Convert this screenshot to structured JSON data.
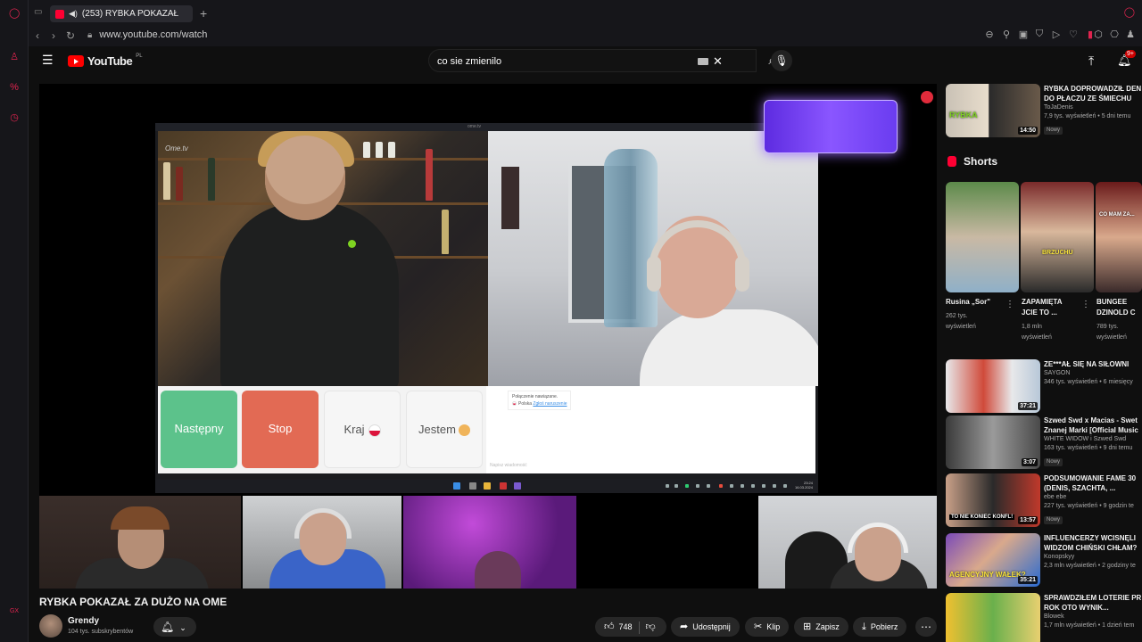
{
  "browser": {
    "tab_title": "(253) RYBKA POKAZAŁ",
    "url": "www.youtube.com/watch",
    "new_tab": "+"
  },
  "youtube": {
    "logo_text": "YouTube",
    "country_code": "PL",
    "search_query": "co sie zmienilo",
    "notification_count": "9+"
  },
  "player": {
    "omegle_logo": "Ome.tv",
    "screen_url": "ome.tv",
    "buttons": {
      "next": "Następny",
      "stop": "Stop",
      "country": "Kraj",
      "gender": "Jestem"
    },
    "chat": {
      "line1": "Połączenie nawiązane.",
      "line2_country": "Polska",
      "line2_link": "Zgłoś naruszenie",
      "input_placeholder": "Napisz wiadomość"
    },
    "clock_time": "23:24",
    "clock_date": "16.03.2024"
  },
  "video": {
    "title": "RYBKA POKAZAŁ ZA DUŻO NA OME",
    "channel": "Grendy",
    "subscribers": "104 tys. subskrybentów",
    "likes": "748",
    "share": "Udostępnij",
    "clip": "Klip",
    "save": "Zapisz",
    "download": "Pobierz",
    "more": "⋯"
  },
  "sidebar": {
    "videos_top": [
      {
        "title": "RYBKA DOPROWADZIŁ DEN",
        "title2": "DO PŁACZU ZE ŚMIECHU",
        "channel": "ToJaDenis",
        "meta": "7,9 tys. wyświetleń • 5 dni temu",
        "badge": "Nowy",
        "duration": "14:50",
        "thumb_text": "RYBKA"
      }
    ],
    "shorts_label": "Shorts",
    "shorts": [
      {
        "title": "Rusina „Sor\"",
        "views": "262 tys.",
        "views2": "wyświetleń",
        "overlay": ""
      },
      {
        "title": "ZAPAMIĘTA",
        "title2": "JCIE TO ...",
        "views": "1,8 mln",
        "views2": "wyświetleń",
        "overlay": "BRZUCHU"
      },
      {
        "title": "BUNGEE",
        "title2": "DZINOLD C",
        "views": "789 tys.",
        "views2": "wyświetleń",
        "overlay": "CO MAM ZA..."
      }
    ],
    "videos": [
      {
        "title": "ZE***AŁ SIĘ NA SIŁOWNI",
        "title2": "",
        "channel": "SAYGON",
        "meta": "346 tys. wyświetleń • 6 miesięcy",
        "badge": "",
        "duration": "37:21"
      },
      {
        "title": "Szwed Swd x Macias - Swet",
        "title2": "Znanej Marki [Official Music",
        "channel": "WHITE WIDOW i Szwed Swd",
        "meta": "163 tys. wyświetleń • 9 dni temu",
        "badge": "Nowy",
        "duration": "3:07"
      },
      {
        "title": "PODSUMOWANIE FAME 30",
        "title2": "(DENIS, SZACHTA, ...",
        "channel": "ebe ebe",
        "meta": "227 tys. wyświetleń • 9 godzin te",
        "badge": "Nowy",
        "duration": "13:57",
        "thumb_text": "TO NIE KONIEC KONFL!"
      },
      {
        "title": "INFLUENCERZY WCISNĘLI",
        "title2": "WIDZOM CHIŃSKI CHŁAM?",
        "channel": "Konopskyy",
        "meta": "2,3 mln wyświetleń • 2 godziny te",
        "badge": "",
        "duration": "35:21",
        "thumb_text": "AGENCYJNY WAŁEK?"
      },
      {
        "title": "SPRAWDZIŁEM LOTERIE PR",
        "title2": "ROK OTO WYNIK...",
        "channel": "Blowek",
        "meta": "1,7 mln wyświetleń • 1 dzień tem",
        "badge": "",
        "duration": ""
      }
    ]
  },
  "colors": {
    "accent": "#ff0033",
    "opera": "#e0244f",
    "next_btn": "#5cc28b",
    "stop_btn": "#e26a54"
  }
}
